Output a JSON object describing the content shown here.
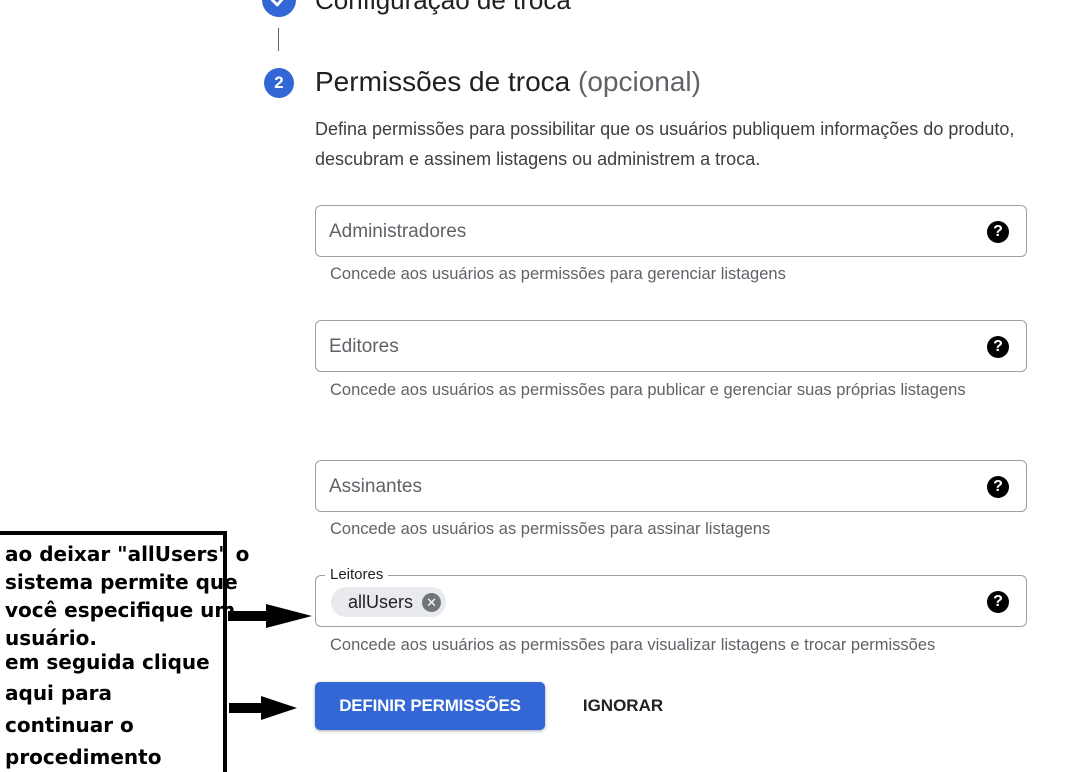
{
  "step1": {
    "title": "Configuração de troca"
  },
  "step2": {
    "number": "2",
    "title": "Permissões de troca",
    "optional": "(opcional)",
    "description": "Defina permissões para possibilitar que os usuários publiquem informações do produto, descubram e assinem listagens ou administrem a troca."
  },
  "fields": {
    "admins": {
      "placeholder": "Administradores",
      "hint": "Concede aos usuários as permissões para gerenciar listagens"
    },
    "editors": {
      "placeholder": "Editores",
      "hint": "Concede aos usuários as permissões para publicar e gerenciar suas próprias listagens"
    },
    "subscribers": {
      "placeholder": "Assinantes",
      "hint": "Concede aos usuários as permissões para assinar listagens"
    },
    "readers": {
      "label": "Leitores",
      "chip": "allUsers",
      "hint": "Concede aos usuários as permissões para visualizar listagens e trocar permissões"
    }
  },
  "buttons": {
    "primary": "DEFINIR PERMISSÕES",
    "secondary": "IGNORAR"
  },
  "annotation": {
    "line1": "ao deixar \"allUsers\" o",
    "line2": "sistema permite que",
    "line3": "você especifique um",
    "line4": "usuário.",
    "line5": "em seguida clique",
    "line6": "aqui para",
    "line7": "continuar o",
    "line8": "procedimento"
  },
  "icons": {
    "help": "help-circle-icon",
    "check": "check-icon",
    "chip_remove": "cancel-icon"
  },
  "colors": {
    "accent": "#3367d6",
    "text_primary": "#202124",
    "text_secondary": "#5f6368",
    "border": "#9aa0a6"
  }
}
